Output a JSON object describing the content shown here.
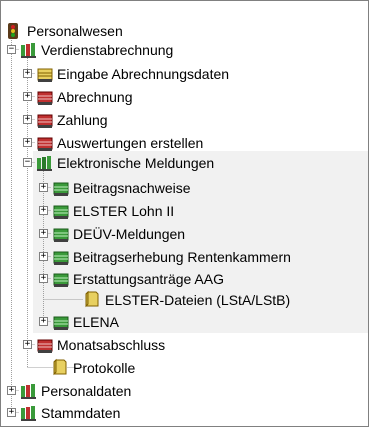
{
  "tree": {
    "root": {
      "label": "Personalwesen",
      "icon": "traffic-light-icon"
    },
    "verdienstabrechnung": {
      "label": "Verdienstabrechnung",
      "icon": "green-red-group-icon"
    },
    "eingabe": {
      "label": "Eingabe Abrechnungsdaten",
      "icon": "yellow-table-icon"
    },
    "abrechnung": {
      "label": "Abrechnung",
      "icon": "red-table-icon"
    },
    "zahlung": {
      "label": "Zahlung",
      "icon": "red-table-icon"
    },
    "auswertungen": {
      "label": "Auswertungen erstellen",
      "icon": "red-table-icon"
    },
    "elektronische": {
      "label": "Elektronische Meldungen",
      "icon": "green-group-icon"
    },
    "beitragsnachweise": {
      "label": "Beitragsnachweise",
      "icon": "green-table-icon"
    },
    "elster_lohn": {
      "label": "ELSTER Lohn II",
      "icon": "green-table-icon"
    },
    "deuev": {
      "label": "DEÜV-Meldungen",
      "icon": "green-table-icon"
    },
    "beitragserhebung": {
      "label": "Beitragserhebung Rentenkammern",
      "icon": "green-table-icon"
    },
    "erstattung": {
      "label": "Erstattungsanträge AAG",
      "icon": "green-table-icon"
    },
    "elster_dateien": {
      "label": "ELSTER-Dateien (LStA/LStB)",
      "icon": "yellow-document-icon"
    },
    "elena": {
      "label": "ELENA",
      "icon": "green-table-icon"
    },
    "monatsabschluss": {
      "label": "Monatsabschluss",
      "icon": "red-table-icon"
    },
    "protokolle": {
      "label": "Protokolle",
      "icon": "yellow-document-icon"
    },
    "personaldaten": {
      "label": "Personaldaten",
      "icon": "green-red-group-icon"
    },
    "stammdaten": {
      "label": "Stammdaten",
      "icon": "green-red-group-icon"
    }
  },
  "colors": {
    "highlight_bg": "#f1f1f1",
    "tree_line": "#a0a0a0",
    "green": "#3a9a3a",
    "red": "#c03030",
    "yellow": "#e8d060"
  }
}
